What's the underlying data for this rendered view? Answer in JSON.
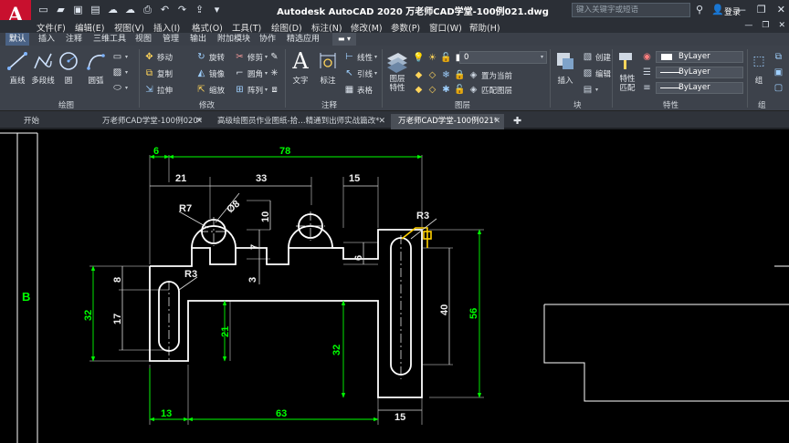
{
  "app": {
    "logo_letter": "A",
    "window_title": "Autodesk AutoCAD 2020    万老师CAD学堂-100例021.dwg",
    "search_placeholder": "键入关键字或短语",
    "signin_label": "登录"
  },
  "menu": [
    "文件(F)",
    "编辑(E)",
    "视图(V)",
    "插入(I)",
    "格式(O)",
    "工具(T)",
    "绘图(D)",
    "标注(N)",
    "修改(M)",
    "参数(P)",
    "窗口(W)",
    "帮助(H)"
  ],
  "ribbon_tabs": [
    "默认",
    "插入",
    "注释",
    "三维工具",
    "视图",
    "管理",
    "输出",
    "附加模块",
    "协作",
    "精选应用"
  ],
  "ribbon": {
    "draw": {
      "group_label": "绘图",
      "buttons": [
        "直线",
        "多段线",
        "圆",
        "圆弧"
      ]
    },
    "modify": {
      "group_label": "修改",
      "buttons": [
        "移动",
        "旋转",
        "修剪",
        "复制",
        "镜像",
        "圆角",
        "拉伸",
        "缩放",
        "阵列"
      ]
    },
    "annotation": {
      "group_label": "注释",
      "big_buttons": [
        "文字",
        "标注"
      ],
      "small_buttons": [
        "线性",
        "引线",
        "表格"
      ]
    },
    "layers": {
      "group_label": "图层",
      "big_button": "图层\n特性",
      "current_layer": "0",
      "small_buttons": [
        "置为当前",
        "匹配图层"
      ]
    },
    "block": {
      "group_label": "块",
      "big_button": "插入",
      "small_buttons": [
        "创建",
        "编辑"
      ]
    },
    "properties": {
      "group_label": "特性",
      "big_button": "特性\n匹配",
      "values": [
        "ByLayer",
        "ByLayer",
        "ByLayer"
      ]
    },
    "group": {
      "group_label": "组",
      "big_button": "组"
    }
  },
  "doc_tabs": [
    {
      "label": "开始",
      "active": false,
      "closable": false
    },
    {
      "label": "万老师CAD学堂-100例020*",
      "active": false,
      "closable": true
    },
    {
      "label": "高级绘图员作业图纸-拾…精通到出师实战篇改*",
      "active": false,
      "closable": true
    },
    {
      "label": "万老师CAD学堂-100例021*",
      "active": true,
      "closable": true
    }
  ],
  "drawing": {
    "side_label": "B",
    "dimensions": {
      "top_6": "6",
      "top_78": "78",
      "top_21": "21",
      "top_33": "33",
      "top_15": "15",
      "r7": "R7",
      "dia8": "Ø8",
      "v10": "10",
      "v7": "7",
      "v3": "3",
      "v6": "6",
      "r3_left": "R3",
      "r3_right": "R3",
      "v8": "8",
      "v17": "17",
      "v32_left": "32",
      "v21": "21",
      "v32_mid": "32",
      "v40": "40",
      "v56": "56",
      "bottom_13": "13",
      "bottom_63": "63",
      "bottom_15": "15"
    }
  },
  "colors": {
    "accent_tab": "#4a6285",
    "dim_green": "#00ff00",
    "geometry_white": "#ffffff",
    "extension_gray": "#9a9a9a",
    "highlight_yellow": "#ffd000",
    "logo_red": "#c8102e"
  }
}
